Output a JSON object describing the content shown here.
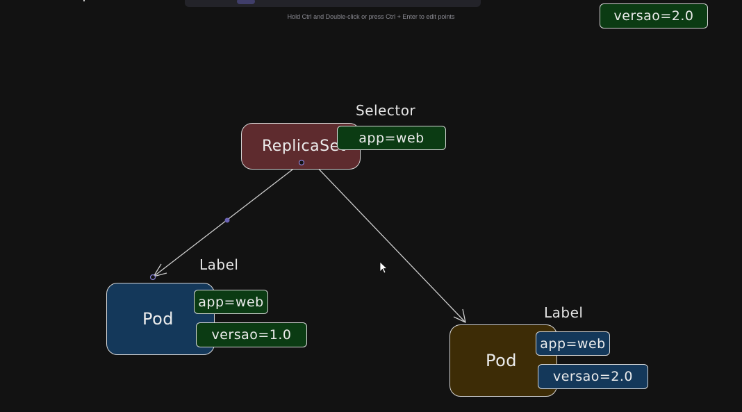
{
  "hint": "Hold Ctrl and Double-click or press Ctrl + Enter to edit points",
  "top_tag": "versao=2.0",
  "replicaset": {
    "label": "ReplicaSet",
    "selector_title": "Selector",
    "selector_tag": "app=web"
  },
  "pod_left": {
    "label": "Pod",
    "title": "Label",
    "tags": [
      "app=web",
      "versao=1.0"
    ]
  },
  "pod_right": {
    "label": "Pod",
    "title": "Label",
    "tags": [
      "app=web",
      "versao=2.0"
    ]
  },
  "colors": {
    "background": "#121212",
    "tag_green": "#0b3b13",
    "tag_blue": "#14385a",
    "replicaset": "#5e2b2e",
    "pod_left": "#14385a",
    "pod_right": "#3d2c06",
    "stroke": "#d8d8d8",
    "selection_point": "#6b63b5"
  }
}
